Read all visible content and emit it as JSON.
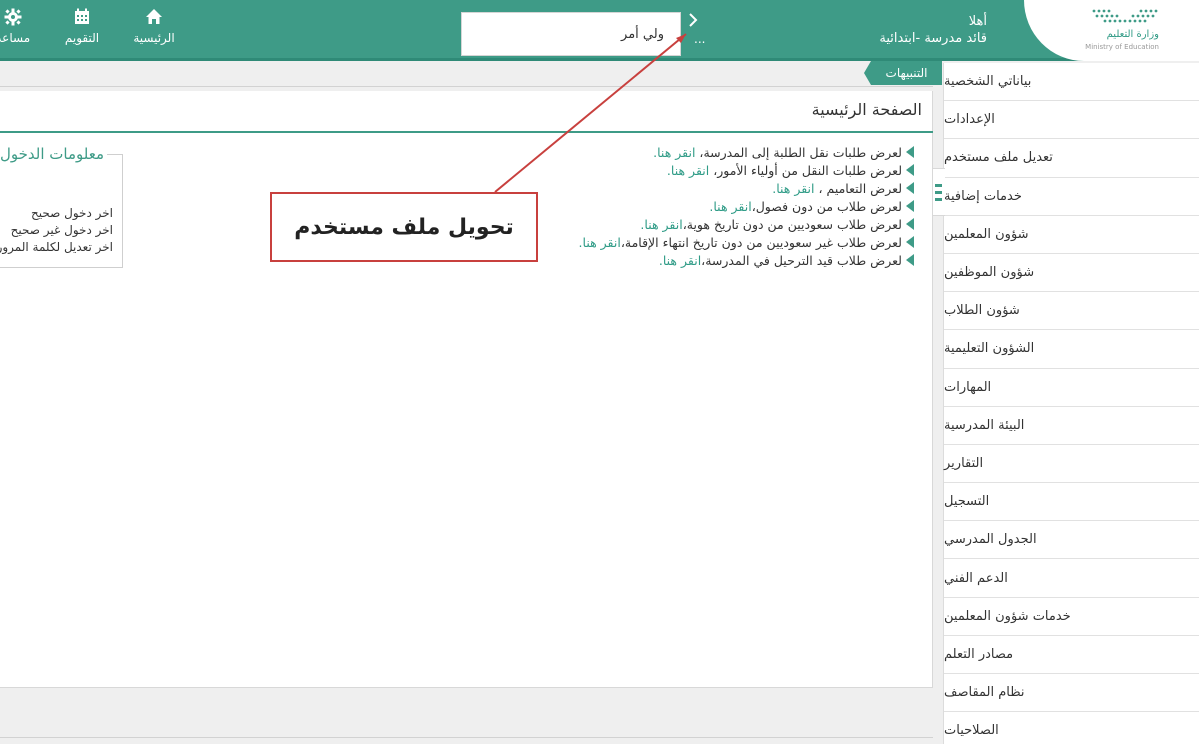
{
  "header": {
    "logo": {
      "text": "وزارة التعليم",
      "sub": "Ministry of Education"
    },
    "greeting": "أهلا",
    "role": "قائد مدرسة -ابتدائية",
    "role_selector": {
      "value": "ولي أمر",
      "more": "..."
    },
    "nav": [
      {
        "label": "الرئيسية",
        "icon": "home-icon"
      },
      {
        "label": "التقويم",
        "icon": "calendar-icon"
      },
      {
        "label": "مساعد",
        "icon": "gear-icon"
      }
    ]
  },
  "sidebar": {
    "items": [
      {
        "label": "بياناتي الشخصية"
      },
      {
        "label": "الإعدادات"
      },
      {
        "label": "تعديل ملف مستخدم"
      },
      {
        "label": "خدمات إضافية"
      },
      {
        "label": "شؤون المعلمين"
      },
      {
        "label": "شؤون الموظفين"
      },
      {
        "label": "شؤون الطلاب"
      },
      {
        "label": "الشؤون التعليمية"
      },
      {
        "label": "المهارات"
      },
      {
        "label": "البيئة المدرسية"
      },
      {
        "label": "التقارير"
      },
      {
        "label": "التسجيل"
      },
      {
        "label": "الجدول المدرسي"
      },
      {
        "label": "الدعم الفني"
      },
      {
        "label": "خدمات شؤون المعلمين"
      },
      {
        "label": "مصادر التعلم"
      },
      {
        "label": "نظام المقاصف"
      },
      {
        "label": "الصلاحيات"
      }
    ]
  },
  "main": {
    "notifications_tab": "التنبيهات",
    "page_title": "الصفحة الرئيسية",
    "alerts": [
      {
        "text": "لعرض طلبات نقل الطلبة إلى المدرسة، ",
        "link": "انقر هنا."
      },
      {
        "text": "لعرض طلبات النقل من أولياء الأمور، ",
        "link": "انقر هنا."
      },
      {
        "text": "لعرض التعاميم ، ",
        "link": "انقر هنا."
      },
      {
        "text": "لعرض طلاب من دون فصول،",
        "link": "انقر هنا."
      },
      {
        "text": "لعرض طلاب سعوديين من دون تاريخ هوية،",
        "link": "انقر هنا."
      },
      {
        "text": "لعرض طلاب غير سعوديين من دون تاريخ انتهاء الإقامة،",
        "link": "انقر هنا."
      },
      {
        "text": "لعرض طلاب قيد الترحيل في المدرسة،",
        "link": "انقر هنا."
      }
    ],
    "login_info": {
      "title": "معلومات الدخول",
      "lines": [
        "اخر دخول صحيح",
        "اخر دخول غير صحيح",
        "اخر تعديل لكلمة المرور"
      ]
    }
  },
  "annotation": {
    "label": "تحويل ملف مستخدم",
    "color": "#c8403e"
  },
  "colors": {
    "brand": "#3e9b87",
    "link": "#2e9b86",
    "annotation": "#c8403e"
  }
}
